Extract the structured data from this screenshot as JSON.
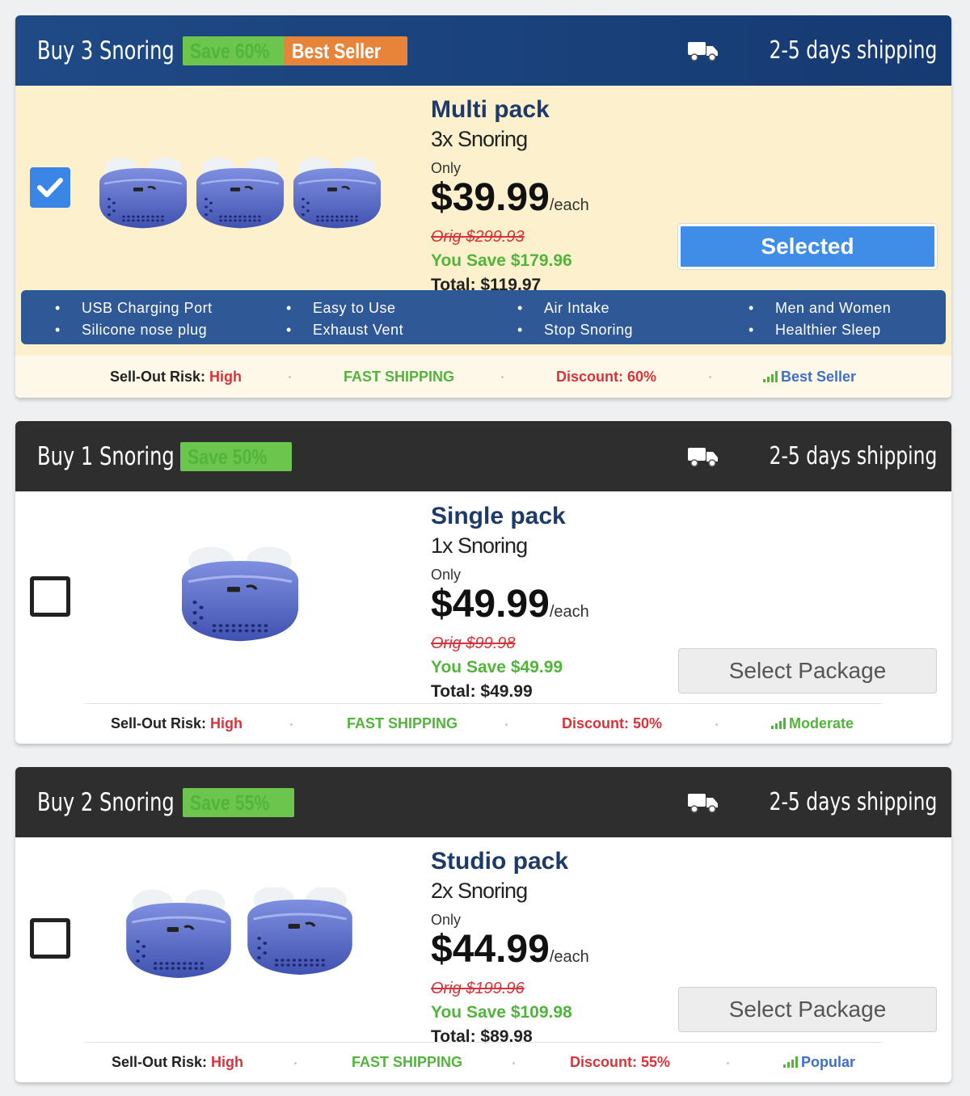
{
  "cards": [
    {
      "header_title": "Buy 3 Snoring",
      "save_badge": "Save 60%",
      "extra_badge": "Best Seller",
      "shipping": "2-5 days shipping",
      "pack_name": "Multi pack",
      "pack_sub": "3x Snoring",
      "only": "Only",
      "price": "$39.99",
      "per": "/each",
      "orig": "Orig $299.93",
      "save": "You Save $179.96",
      "total": "Total: $119.97",
      "button": "Selected",
      "checked": true,
      "features": [
        [
          "USB Charging Port",
          "Silicone nose plug"
        ],
        [
          "Easy to Use",
          "Exhaust Vent"
        ],
        [
          "Air Intake",
          "Stop Snoring"
        ],
        [
          "Men and Women",
          "Healthier Sleep"
        ]
      ],
      "stats": {
        "risk_label": "Sell-Out Risk:",
        "risk_value": "High",
        "shipping": "FAST SHIPPING",
        "discount": "Discount: 60%",
        "popularity": "Best Seller"
      }
    },
    {
      "header_title": "Buy 1 Snoring",
      "save_badge": "Save 50%",
      "shipping": "2-5 days shipping",
      "pack_name": "Single pack",
      "pack_sub": "1x Snoring",
      "only": "Only",
      "price": "$49.99",
      "per": "/each",
      "orig": "Orig $99.98",
      "save": "You Save $49.99",
      "total": "Total: $49.99",
      "button": "Select Package",
      "checked": false,
      "stats": {
        "risk_label": "Sell-Out Risk:",
        "risk_value": "High",
        "shipping": "FAST SHIPPING",
        "discount": "Discount: 50%",
        "popularity": "Moderate"
      }
    },
    {
      "header_title": "Buy 2 Snoring",
      "save_badge": "Save 55%",
      "shipping": "2-5 days shipping",
      "pack_name": "Studio pack",
      "pack_sub": "2x Snoring",
      "only": "Only",
      "price": "$44.99",
      "per": "/each",
      "orig": "Orig $199.96",
      "save": "You Save $109.98",
      "total": "Total: $89.98",
      "button": "Select Package",
      "checked": false,
      "stats": {
        "risk_label": "Sell-Out Risk:",
        "risk_value": "High",
        "shipping": "FAST SHIPPING",
        "discount": "Discount: 55%",
        "popularity": "Popular"
      }
    }
  ],
  "colors": {
    "header_blue": "#1f4a86",
    "header_dark": "#2e2e2e",
    "selected_bg": "#fcf1cc",
    "accent_blue": "#3f8de6",
    "save_green": "#52b43c",
    "risk_red": "#d8333a"
  },
  "icons": {
    "truck": "truck-icon",
    "check": "check-icon",
    "signal": "signal-bars-icon",
    "product": "nose-device-icon"
  }
}
